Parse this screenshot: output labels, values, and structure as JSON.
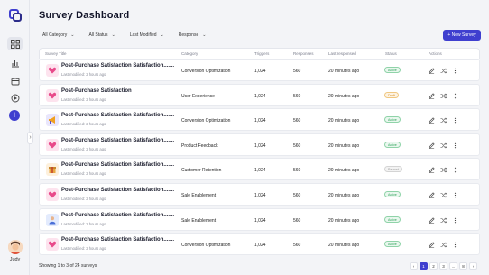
{
  "page": {
    "title": "Survey Dashboard"
  },
  "colors": {
    "accent": "#3f3fcf",
    "active_badge": "#2ea35a",
    "draft_badge": "#e0a23a",
    "paused_badge": "#a8a8a8"
  },
  "sidebar": {
    "icons": [
      "logo-icon",
      "grid-icon",
      "chart-icon",
      "calendar-icon",
      "play-icon",
      "plus-icon"
    ],
    "user": {
      "name": "Judy"
    }
  },
  "filters": [
    {
      "label": "All Category"
    },
    {
      "label": "All Status"
    },
    {
      "label": "Last Modified"
    },
    {
      "label": "Response"
    }
  ],
  "new_survey_label": "+ New Survey",
  "table": {
    "headers": [
      "Survey Title",
      "Category",
      "Triggers",
      "Responses",
      "Last responsed",
      "Status",
      "Actions"
    ],
    "rows": [
      {
        "title": "Post-Purchase Satisfaction Satisfaction.......",
        "modified": "Last modified: 2 hours ago",
        "category": "Conversion Optimization",
        "triggers": "1,024",
        "responses": "560",
        "last": "20 minutes ago",
        "status": "Active",
        "thumb": "heart-icon"
      },
      {
        "title": "Post-Purchase Satisfaction",
        "modified": "Last modified: 2 hours ago",
        "category": "User Experience",
        "triggers": "1,024",
        "responses": "560",
        "last": "20 minutes ago",
        "status": "Draft",
        "thumb": "heart-icon"
      },
      {
        "title": "Post-Purchase Satisfaction Satisfaction.......",
        "modified": "Last modified: 2 hours ago",
        "category": "Conversion Optimization",
        "triggers": "1,024",
        "responses": "560",
        "last": "20 minutes ago",
        "status": "Active",
        "thumb": "megaphone-icon"
      },
      {
        "title": "Post-Purchase Satisfaction Satisfaction.......",
        "modified": "Last modified: 2 hours ago",
        "category": "Product Feedback",
        "triggers": "1,024",
        "responses": "560",
        "last": "20 minutes ago",
        "status": "Active",
        "thumb": "heart-icon"
      },
      {
        "title": "Post-Purchase Satisfaction Satisfaction.......",
        "modified": "Last modified: 2 hours ago",
        "category": "Customer Retention",
        "triggers": "1,024",
        "responses": "560",
        "last": "20 minutes ago",
        "status": "Paused",
        "thumb": "box-icon"
      },
      {
        "title": "Post-Purchase Satisfaction Satisfaction.......",
        "modified": "Last modified: 2 hours ago",
        "category": "Sale Enablement",
        "triggers": "1,024",
        "responses": "560",
        "last": "20 minutes ago",
        "status": "Active",
        "thumb": "heart-icon"
      },
      {
        "title": "Post-Purchase Satisfaction Satisfaction.......",
        "modified": "Last modified: 2 hours ago",
        "category": "Sale Enablement",
        "triggers": "1,024",
        "responses": "560",
        "last": "20 minutes ago",
        "status": "Active",
        "thumb": "person-icon"
      },
      {
        "title": "Post-Purchase Satisfaction Satisfaction.......",
        "modified": "Last modified: 2 hours ago",
        "category": "Conversion Optimization",
        "triggers": "1,024",
        "responses": "560",
        "last": "20 minutes ago",
        "status": "Active",
        "thumb": "heart-icon"
      }
    ]
  },
  "footer": {
    "showing": "Showing 1 to 3 of 24 surveys",
    "pages": [
      "‹",
      "1",
      "2",
      "3",
      "...",
      "8",
      "›"
    ],
    "current_page": "1"
  }
}
